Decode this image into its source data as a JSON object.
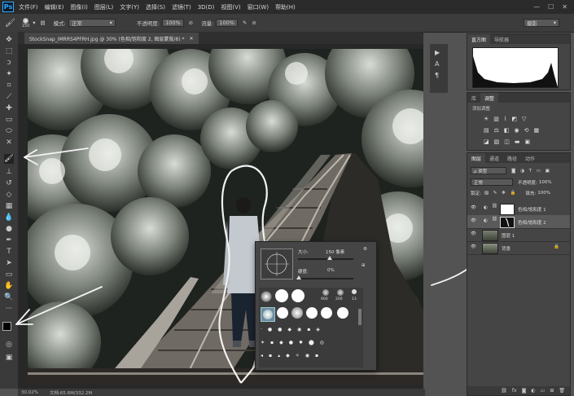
{
  "menu": {
    "logo": "Ps",
    "items": [
      "文件(F)",
      "编辑(E)",
      "图像(I)",
      "图层(L)",
      "文字(Y)",
      "选择(S)",
      "滤镜(T)",
      "3D(D)",
      "视图(V)",
      "窗口(W)",
      "帮助(H)"
    ],
    "window_controls": [
      "—",
      "☐",
      "✕"
    ]
  },
  "options": {
    "brush_size": "150",
    "mode_label": "模式:",
    "mode_value": "正常",
    "opacity_label": "不透明度:",
    "opacity_value": "100%",
    "flow_label": "流量:",
    "flow_value": "100%",
    "workspace": "摄影"
  },
  "document": {
    "tab_title": "StockSnap_IMRRS4PFRH.jpg @ 30% (色相/饱和度 2, 图层蒙版/8) *",
    "zoom": "30.02%",
    "doc_size": "文档:65.6M/332.2M"
  },
  "histogram": {
    "tabs": [
      "直方图",
      "导航器"
    ]
  },
  "adjustments": {
    "tabs": [
      "库",
      "调整"
    ],
    "add_label": "添加调整"
  },
  "layers": {
    "tabs": [
      "图层",
      "通道",
      "路径",
      "动作"
    ],
    "filter_label": "ρ 类型",
    "blend_mode": "正常",
    "opacity_label": "不透明度:",
    "opacity_value": "100%",
    "lock_label": "锁定:",
    "fill_label": "填充:",
    "fill_value": "100%",
    "items": [
      {
        "name": "色相/饱和度 1"
      },
      {
        "name": "色相/饱和度 2"
      },
      {
        "name": "图层 1"
      },
      {
        "name": "背景"
      }
    ],
    "footer_icons": [
      "fx"
    ]
  },
  "brush_picker": {
    "size_label": "大小:",
    "size_value": "150 像素",
    "hardness_label": "硬度:",
    "hardness_value": "0%",
    "preset_numbers": [
      "900",
      "200",
      "13"
    ]
  }
}
